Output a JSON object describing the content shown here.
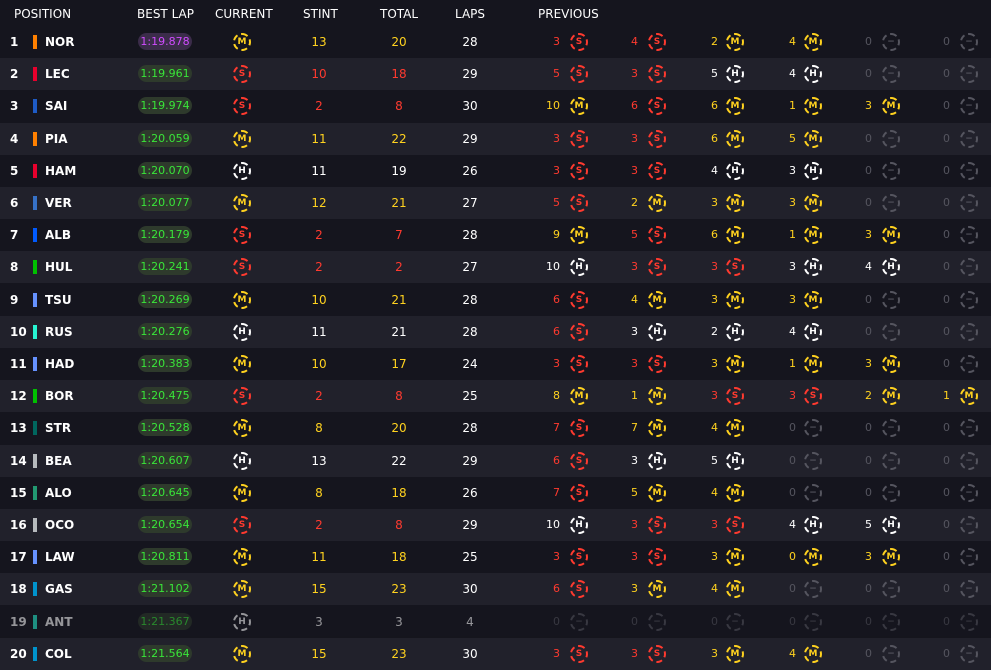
{
  "headers": {
    "position": "POSITION",
    "best_lap": "BEST LAP",
    "current": "CURRENT",
    "stint": "STINT",
    "total": "TOTAL",
    "laps": "LAPS",
    "previous": "PREVIOUS"
  },
  "compound_colors": {
    "S": "#ff3a2f",
    "M": "#ffd21f",
    "H": "#ffffff",
    "N": "#55555f"
  },
  "team_colors": {
    "NOR": "#ff8000",
    "LEC": "#e8002d",
    "SAI": "#1e5bc6",
    "PIA": "#ff8000",
    "HAM": "#e8002d",
    "VER": "#3671c6",
    "ALB": "#005aff",
    "HUL": "#00c000",
    "TSU": "#6692ff",
    "RUS": "#27f4d2",
    "HAD": "#6692ff",
    "BOR": "#00c000",
    "STR": "#00665e",
    "BEA": "#b6babd",
    "ALO": "#229971",
    "OCO": "#b6babd",
    "LAW": "#6692ff",
    "GAS": "#0093cc",
    "ANT": "#27f4d2",
    "COL": "#0093cc"
  },
  "rows": [
    {
      "pos": "1",
      "code": "NOR",
      "best": "1:19.878",
      "fastest": true,
      "cur": "M",
      "stint": "13",
      "total": "20",
      "laps": "28",
      "prev": [
        [
          "3",
          "S"
        ],
        [
          "4",
          "S"
        ],
        [
          "2",
          "M"
        ],
        [
          "4",
          "M"
        ],
        [
          "0",
          "N"
        ],
        [
          "0",
          "N"
        ]
      ]
    },
    {
      "pos": "2",
      "code": "LEC",
      "best": "1:19.961",
      "cur": "S",
      "stint": "10",
      "total": "18",
      "laps": "29",
      "prev": [
        [
          "5",
          "S"
        ],
        [
          "3",
          "S"
        ],
        [
          "5",
          "H"
        ],
        [
          "4",
          "H"
        ],
        [
          "0",
          "N"
        ],
        [
          "0",
          "N"
        ]
      ]
    },
    {
      "pos": "3",
      "code": "SAI",
      "best": "1:19.974",
      "cur": "S",
      "stint": "2",
      "total": "8",
      "laps": "30",
      "prev": [
        [
          "10",
          "M"
        ],
        [
          "6",
          "S"
        ],
        [
          "6",
          "M"
        ],
        [
          "1",
          "M"
        ],
        [
          "3",
          "M"
        ],
        [
          "0",
          "N"
        ]
      ]
    },
    {
      "pos": "4",
      "code": "PIA",
      "best": "1:20.059",
      "cur": "M",
      "stint": "11",
      "total": "22",
      "laps": "29",
      "prev": [
        [
          "3",
          "S"
        ],
        [
          "3",
          "S"
        ],
        [
          "6",
          "M"
        ],
        [
          "5",
          "M"
        ],
        [
          "0",
          "N"
        ],
        [
          "0",
          "N"
        ]
      ]
    },
    {
      "pos": "5",
      "code": "HAM",
      "best": "1:20.070",
      "cur": "H",
      "stint": "11",
      "total": "19",
      "laps": "26",
      "prev": [
        [
          "3",
          "S"
        ],
        [
          "3",
          "S"
        ],
        [
          "4",
          "H"
        ],
        [
          "3",
          "H"
        ],
        [
          "0",
          "N"
        ],
        [
          "0",
          "N"
        ]
      ]
    },
    {
      "pos": "6",
      "code": "VER",
      "best": "1:20.077",
      "cur": "M",
      "stint": "12",
      "total": "21",
      "laps": "27",
      "prev": [
        [
          "5",
          "S"
        ],
        [
          "2",
          "M"
        ],
        [
          "3",
          "M"
        ],
        [
          "3",
          "M"
        ],
        [
          "0",
          "N"
        ],
        [
          "0",
          "N"
        ]
      ]
    },
    {
      "pos": "7",
      "code": "ALB",
      "best": "1:20.179",
      "cur": "S",
      "stint": "2",
      "total": "7",
      "laps": "28",
      "prev": [
        [
          "9",
          "M"
        ],
        [
          "5",
          "S"
        ],
        [
          "6",
          "M"
        ],
        [
          "1",
          "M"
        ],
        [
          "3",
          "M"
        ],
        [
          "0",
          "N"
        ]
      ]
    },
    {
      "pos": "8",
      "code": "HUL",
      "best": "1:20.241",
      "cur": "S",
      "stint": "2",
      "total": "2",
      "laps": "27",
      "prev": [
        [
          "10",
          "H"
        ],
        [
          "3",
          "S"
        ],
        [
          "3",
          "S"
        ],
        [
          "3",
          "H"
        ],
        [
          "4",
          "H"
        ],
        [
          "0",
          "N"
        ]
      ]
    },
    {
      "pos": "9",
      "code": "TSU",
      "best": "1:20.269",
      "cur": "M",
      "stint": "10",
      "total": "21",
      "laps": "28",
      "prev": [
        [
          "6",
          "S"
        ],
        [
          "4",
          "M"
        ],
        [
          "3",
          "M"
        ],
        [
          "3",
          "M"
        ],
        [
          "0",
          "N"
        ],
        [
          "0",
          "N"
        ]
      ]
    },
    {
      "pos": "10",
      "code": "RUS",
      "best": "1:20.276",
      "cur": "H",
      "stint": "11",
      "total": "21",
      "laps": "28",
      "prev": [
        [
          "6",
          "S"
        ],
        [
          "3",
          "H"
        ],
        [
          "2",
          "H"
        ],
        [
          "4",
          "H"
        ],
        [
          "0",
          "N"
        ],
        [
          "0",
          "N"
        ]
      ]
    },
    {
      "pos": "11",
      "code": "HAD",
      "best": "1:20.383",
      "cur": "M",
      "stint": "10",
      "total": "17",
      "laps": "24",
      "prev": [
        [
          "3",
          "S"
        ],
        [
          "3",
          "S"
        ],
        [
          "3",
          "M"
        ],
        [
          "1",
          "M"
        ],
        [
          "3",
          "M"
        ],
        [
          "0",
          "N"
        ]
      ]
    },
    {
      "pos": "12",
      "code": "BOR",
      "best": "1:20.475",
      "cur": "S",
      "stint": "2",
      "total": "8",
      "laps": "25",
      "prev": [
        [
          "8",
          "M"
        ],
        [
          "1",
          "M"
        ],
        [
          "3",
          "S"
        ],
        [
          "3",
          "S"
        ],
        [
          "2",
          "M"
        ],
        [
          "1",
          "M"
        ]
      ]
    },
    {
      "pos": "13",
      "code": "STR",
      "best": "1:20.528",
      "cur": "M",
      "stint": "8",
      "total": "20",
      "laps": "28",
      "prev": [
        [
          "7",
          "S"
        ],
        [
          "7",
          "M"
        ],
        [
          "4",
          "M"
        ],
        [
          "0",
          "N"
        ],
        [
          "0",
          "N"
        ],
        [
          "0",
          "N"
        ]
      ]
    },
    {
      "pos": "14",
      "code": "BEA",
      "best": "1:20.607",
      "cur": "H",
      "stint": "13",
      "total": "22",
      "laps": "29",
      "prev": [
        [
          "6",
          "S"
        ],
        [
          "3",
          "H"
        ],
        [
          "5",
          "H"
        ],
        [
          "0",
          "N"
        ],
        [
          "0",
          "N"
        ],
        [
          "0",
          "N"
        ]
      ]
    },
    {
      "pos": "15",
      "code": "ALO",
      "best": "1:20.645",
      "cur": "M",
      "stint": "8",
      "total": "18",
      "laps": "26",
      "prev": [
        [
          "7",
          "S"
        ],
        [
          "5",
          "M"
        ],
        [
          "4",
          "M"
        ],
        [
          "0",
          "N"
        ],
        [
          "0",
          "N"
        ],
        [
          "0",
          "N"
        ]
      ]
    },
    {
      "pos": "16",
      "code": "OCO",
      "best": "1:20.654",
      "cur": "S",
      "stint": "2",
      "total": "8",
      "laps": "29",
      "prev": [
        [
          "10",
          "H"
        ],
        [
          "3",
          "S"
        ],
        [
          "3",
          "S"
        ],
        [
          "4",
          "H"
        ],
        [
          "5",
          "H"
        ],
        [
          "0",
          "N"
        ]
      ]
    },
    {
      "pos": "17",
      "code": "LAW",
      "best": "1:20.811",
      "cur": "M",
      "stint": "11",
      "total": "18",
      "laps": "25",
      "prev": [
        [
          "3",
          "S"
        ],
        [
          "3",
          "S"
        ],
        [
          "3",
          "M"
        ],
        [
          "0",
          "M"
        ],
        [
          "3",
          "M"
        ],
        [
          "0",
          "N"
        ]
      ]
    },
    {
      "pos": "18",
      "code": "GAS",
      "best": "1:21.102",
      "cur": "M",
      "stint": "15",
      "total": "23",
      "laps": "30",
      "prev": [
        [
          "6",
          "S"
        ],
        [
          "3",
          "M"
        ],
        [
          "4",
          "M"
        ],
        [
          "0",
          "N"
        ],
        [
          "0",
          "N"
        ],
        [
          "0",
          "N"
        ]
      ]
    },
    {
      "pos": "19",
      "code": "ANT",
      "best": "1:21.367",
      "cur": "H",
      "stint": "3",
      "total": "3",
      "laps": "4",
      "retired": true,
      "prev": [
        [
          "0",
          "N"
        ],
        [
          "0",
          "N"
        ],
        [
          "0",
          "N"
        ],
        [
          "0",
          "N"
        ],
        [
          "0",
          "N"
        ],
        [
          "0",
          "N"
        ]
      ]
    },
    {
      "pos": "20",
      "code": "COL",
      "best": "1:21.564",
      "cur": "M",
      "stint": "15",
      "total": "23",
      "laps": "30",
      "prev": [
        [
          "3",
          "S"
        ],
        [
          "3",
          "S"
        ],
        [
          "3",
          "M"
        ],
        [
          "4",
          "M"
        ],
        [
          "0",
          "N"
        ],
        [
          "0",
          "N"
        ]
      ]
    }
  ]
}
